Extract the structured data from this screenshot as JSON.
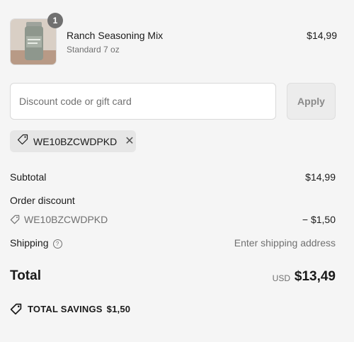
{
  "product": {
    "name": "Ranch Seasoning Mix",
    "variant": "Standard 7 oz",
    "price": "$14,99",
    "quantity": "1"
  },
  "discount": {
    "placeholder": "Discount code or gift card",
    "value": "",
    "apply_label": "Apply"
  },
  "applied_code": {
    "code": "WE10BZCWDPKD",
    "remove_symbol": "✕"
  },
  "summary": {
    "subtotal_label": "Subtotal",
    "subtotal_value": "$14,99",
    "order_discount_label": "Order discount",
    "discount_code": "WE10BZCWDPKD",
    "discount_value": "− $1,50",
    "shipping_label": "Shipping",
    "shipping_help": "?",
    "shipping_value": "Enter shipping address",
    "total_label": "Total",
    "currency": "USD",
    "total_value": "$13,49",
    "savings_label": "TOTAL SAVINGS",
    "savings_value": "$1,50"
  },
  "icons": {
    "tag": "tag-icon",
    "help": "help-circle-icon",
    "close": "close-icon"
  },
  "colors": {
    "background": "#f5f5f5",
    "muted_text": "#707070",
    "chip_bg": "#e6e6e6",
    "badge_bg": "#707070"
  }
}
